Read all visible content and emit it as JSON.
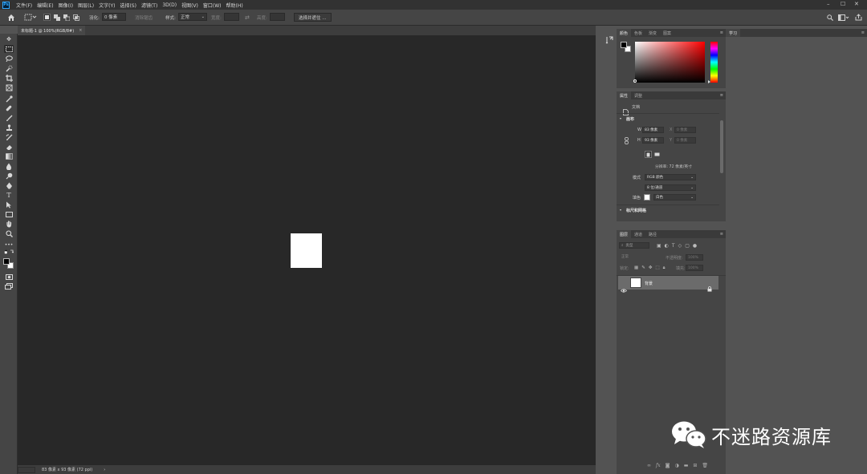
{
  "app": {
    "logo_text": "Ps"
  },
  "menubar": {
    "items": [
      "文件(F)",
      "编辑(E)",
      "图像(I)",
      "图层(L)",
      "文字(Y)",
      "选择(S)",
      "滤镜(T)",
      "3D(D)",
      "视图(V)",
      "窗口(W)",
      "帮助(H)"
    ],
    "window_controls": [
      "–",
      "☐",
      "✕"
    ]
  },
  "options_bar": {
    "feather_label": "羽化:",
    "feather_value": "0 像素",
    "antialias_label": "消除锯齿",
    "style_label": "样式:",
    "style_value": "正常",
    "width_label": "宽度:",
    "height_label": "高度:",
    "select_mask_button": "选择并遮住 ..."
  },
  "document": {
    "tab_title": "未标题-1 @ 100%(RGB/8#)",
    "tab_close": "×",
    "status_text": "83 像素 x 93 像素 (72 ppi)",
    "status_arrow": "›",
    "canvas_color": "#ffffff",
    "pasteboard_color": "#282828"
  },
  "color_panel": {
    "tabs": [
      "颜色",
      "色板",
      "渐变",
      "图案"
    ],
    "foreground": "#000000",
    "background": "#ffffff"
  },
  "properties_panel": {
    "tabs": [
      "属性",
      "调整"
    ],
    "doc_label": "文档",
    "canvas_section": "画布",
    "w_label": "W",
    "w_value": "83 像素",
    "h_label": "H",
    "h_value": "93 像素",
    "x_label": "X",
    "x_value": "0 像素",
    "y_label": "Y",
    "y_value": "0 像素",
    "resolution": "分辨率: 72 像素/英寸",
    "mode_label": "模式",
    "mode_value": "RGB 颜色",
    "depth_value": "8 位/通道",
    "fill_label": "填色",
    "fill_value": "白色",
    "rulers_section": "标尺和网格"
  },
  "layers_panel": {
    "tabs": [
      "图层",
      "通道",
      "路径"
    ],
    "filter_placeholder": "类型",
    "blend_mode": "正常",
    "opacity_label": "不透明度:",
    "opacity_value": "100%",
    "lock_label": "锁定:",
    "fill_label": "填充:",
    "fill_value": "100%",
    "layers": [
      {
        "name": "背景",
        "locked": true,
        "visible": true
      }
    ],
    "footer_icons": [
      "link-icon",
      "fx-icon",
      "mask-icon",
      "adjustment-icon",
      "group-icon",
      "new-layer-icon",
      "trash-icon"
    ]
  },
  "learn_panel": {
    "tab": "学习"
  },
  "watermark": {
    "text": "不迷路资源库"
  }
}
